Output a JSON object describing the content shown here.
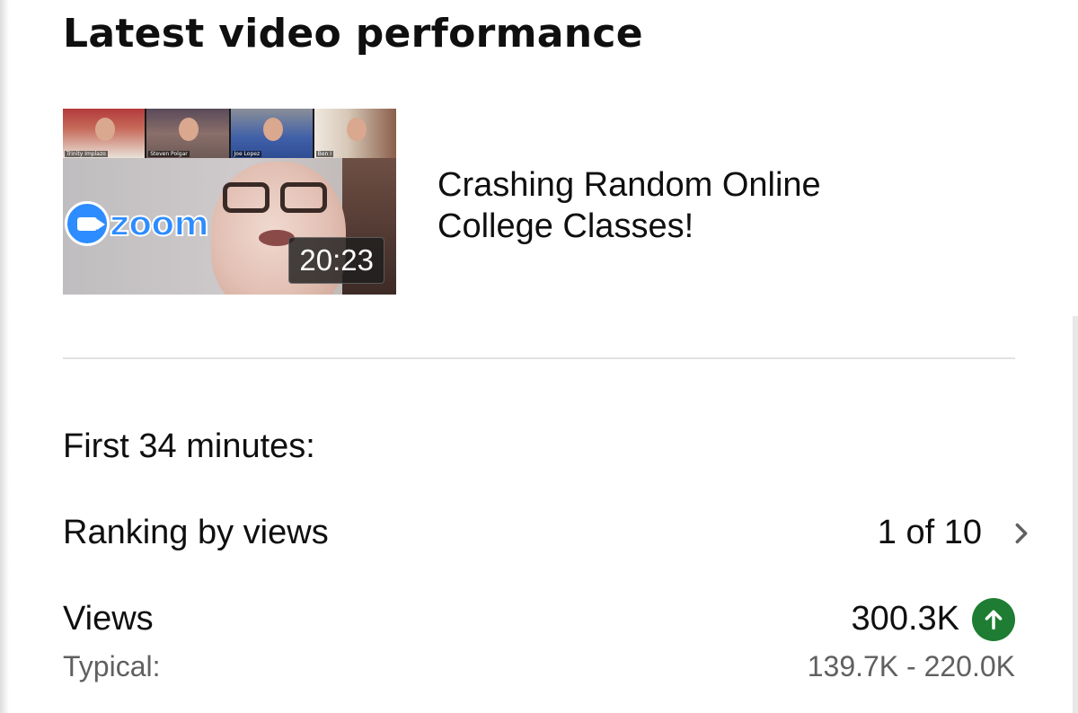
{
  "header": {
    "title": "Latest video performance"
  },
  "video": {
    "title": "Crashing Random Online College Classes!",
    "duration": "20:23",
    "thumbnail": {
      "participants": [
        "Trinity Implazo",
        "Steven Polgar",
        "Joe Lopez",
        "Ben I"
      ],
      "logo_text": "zoom"
    }
  },
  "stats": {
    "period_label": "First 34 minutes:",
    "ranking": {
      "label": "Ranking by views",
      "value": "1 of 10",
      "icon": "chevron-right-icon"
    },
    "views": {
      "label": "Views",
      "value": "300.3K",
      "trend_icon": "arrow-up-icon",
      "trend_color": "#1e7d32",
      "typical_label": "Typical:",
      "typical_range": "139.7K - 220.0K"
    }
  },
  "colors": {
    "text": "#0f0f0f",
    "secondary_text": "#606060",
    "divider": "#e2e2e2",
    "zoom_blue": "#2d8cff"
  }
}
